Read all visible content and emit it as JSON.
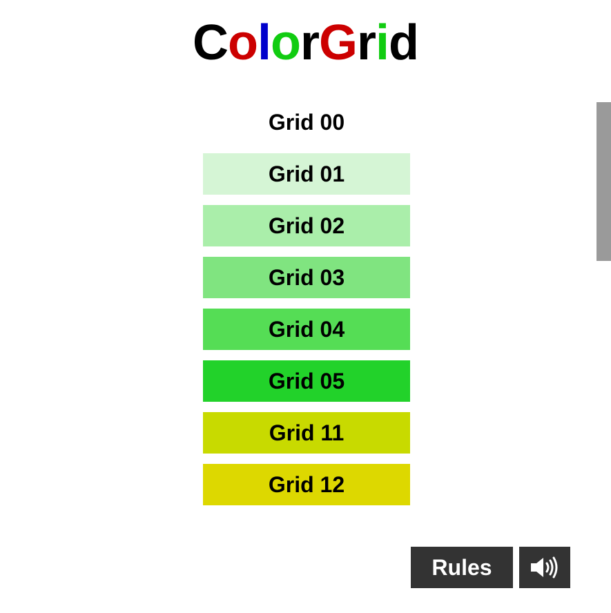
{
  "logo": {
    "letters": [
      {
        "char": "C",
        "color": "#000000"
      },
      {
        "char": "o",
        "color": "#cc0000"
      },
      {
        "char": "l",
        "color": "#0000cc"
      },
      {
        "char": "o",
        "color": "#11cc11"
      },
      {
        "char": "r",
        "color": "#000000"
      },
      {
        "char": "G",
        "color": "#cc0000"
      },
      {
        "char": "r",
        "color": "#000000"
      },
      {
        "char": "i",
        "color": "#11cc11"
      },
      {
        "char": "d",
        "color": "#000000"
      }
    ]
  },
  "grids": [
    {
      "label": "Grid 00",
      "color": "#ffffff"
    },
    {
      "label": "Grid 01",
      "color": "#d5f5d5"
    },
    {
      "label": "Grid 02",
      "color": "#aaeeaa"
    },
    {
      "label": "Grid 03",
      "color": "#80e480"
    },
    {
      "label": "Grid 04",
      "color": "#55dd55"
    },
    {
      "label": "Grid 05",
      "color": "#22d22a"
    },
    {
      "label": "Grid 11",
      "color": "#c8da00"
    },
    {
      "label": "Grid 12",
      "color": "#ddd800"
    }
  ],
  "controls": {
    "rules_label": "Rules",
    "sound_icon": "speaker-on-icon"
  }
}
